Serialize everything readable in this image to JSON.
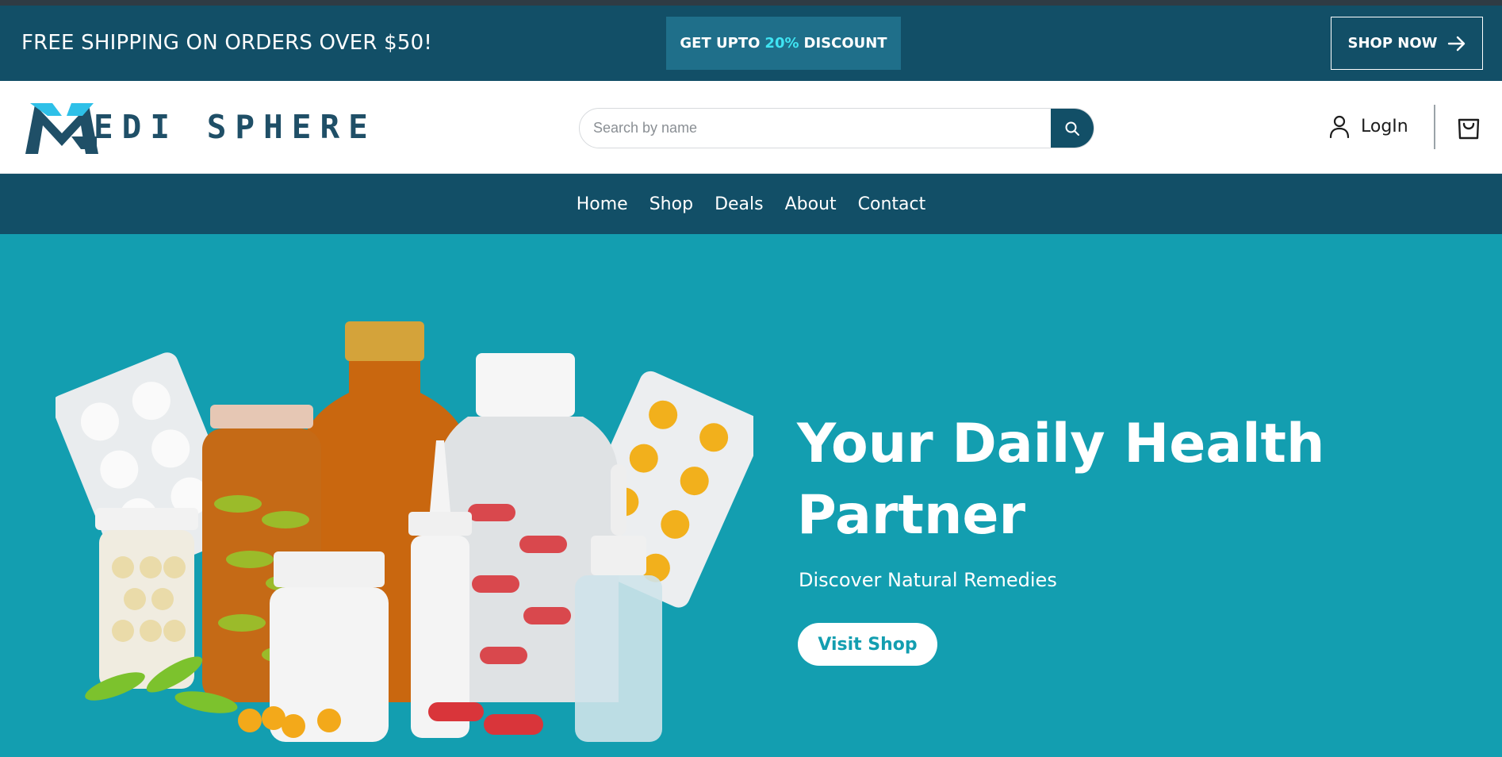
{
  "promo": {
    "left_text": "FREE SHIPPING ON ORDERS OVER $50!",
    "discount_prefix": "GET UPTO",
    "discount_value": "20%",
    "discount_suffix": "DISCOUNT",
    "shop_now": "SHOP NOW"
  },
  "header": {
    "logo_text": "EDI SPHERE",
    "search_placeholder": "Search by name",
    "login": "LogIn",
    "icons": [
      "search-icon",
      "user-icon",
      "shopping-bag-icon",
      "arrow-right-icon"
    ]
  },
  "nav": {
    "items": [
      {
        "label": "Home"
      },
      {
        "label": "Shop"
      },
      {
        "label": "Deals"
      },
      {
        "label": "About"
      },
      {
        "label": "Contact"
      }
    ]
  },
  "hero": {
    "title": "Your Daily Health Partner",
    "subtitle": "Discover Natural Remedies",
    "cta": "Visit Shop"
  },
  "colors": {
    "dark_teal": "#124f67",
    "hero_teal": "#139eb0",
    "discount_highlight": "#3fe4f3"
  }
}
